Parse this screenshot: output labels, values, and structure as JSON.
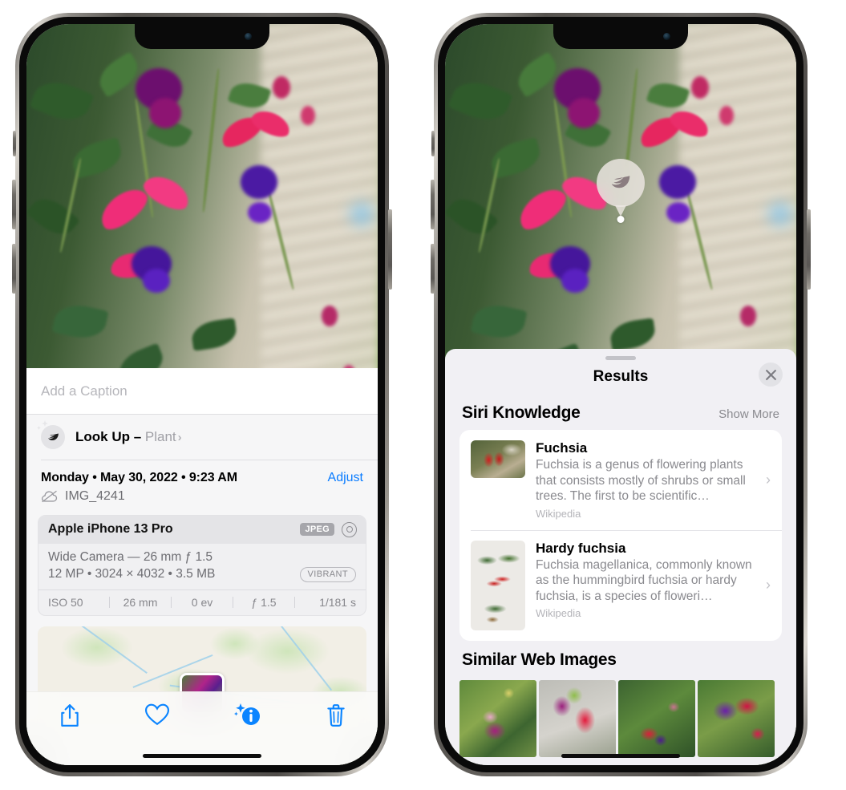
{
  "left_phone": {
    "name": "iphone-13-pro-photos-info",
    "photo": {
      "alt": "fuchsia-flowers-photo"
    },
    "caption_placeholder": "Add a Caption",
    "caption_value": "",
    "lookup": {
      "icon": "leaf-icon",
      "sparkle_icon": "sparkles-icon",
      "label": "Look Up – ",
      "subject": "Plant",
      "chevron": "›"
    },
    "metadata": {
      "date": "Monday • May 30, 2022 • 9:23 AM",
      "adjust_label": "Adjust",
      "cloud_icon": "icloud-slash-icon",
      "filename": "IMG_4241"
    },
    "exif": {
      "device": "Apple iPhone 13 Pro",
      "format_badge": "JPEG",
      "raw_icon": "raw-target-icon",
      "lens": "Wide Camera — 26 mm ƒ 1.5",
      "specs": "12 MP • 3024 × 4032 • 3.5 MB",
      "style_badge": "VIBRANT",
      "details": [
        "ISO 50",
        "26 mm",
        "0 ev",
        "ƒ 1.5",
        "1/181 s"
      ]
    },
    "map": {
      "name": "location-map-thumbnail"
    },
    "toolbar": [
      {
        "name": "share-button",
        "icon": "share-icon"
      },
      {
        "name": "favorite-button",
        "icon": "heart-icon"
      },
      {
        "name": "info-button",
        "icon": "info-sparkle-icon"
      },
      {
        "name": "delete-button",
        "icon": "trash-icon"
      }
    ],
    "accent_color": "#0a84ff"
  },
  "right_phone": {
    "name": "iphone-13-pro-visual-lookup-results",
    "badge": {
      "icon": "leaf-icon",
      "name": "visual-lookup-badge"
    },
    "sheet": {
      "title": "Results",
      "close_icon": "close-x-icon",
      "sections": [
        {
          "title": "Siri Knowledge",
          "action": "Show More",
          "cards": [
            {
              "title": "Fuchsia",
              "description": "Fuchsia is a genus of flowering plants that consists mostly of shrubs or small trees. The first to be scientific…",
              "source": "Wikipedia",
              "thumb": "fuchsia-red-flowers-thumbnail",
              "chevron": "›"
            },
            {
              "title": "Hardy fuchsia",
              "description": "Fuchsia magellanica, commonly known as the hummingbird fuchsia or hardy fuchsia, is a species of floweri…",
              "source": "Wikipedia",
              "thumb": "hardy-fuchsia-specimen-thumbnail",
              "chevron": "›"
            }
          ]
        },
        {
          "title": "Similar Web Images",
          "images": [
            {
              "name": "similar-image-1"
            },
            {
              "name": "similar-image-2"
            },
            {
              "name": "similar-image-3"
            },
            {
              "name": "similar-image-4"
            }
          ]
        }
      ]
    }
  }
}
